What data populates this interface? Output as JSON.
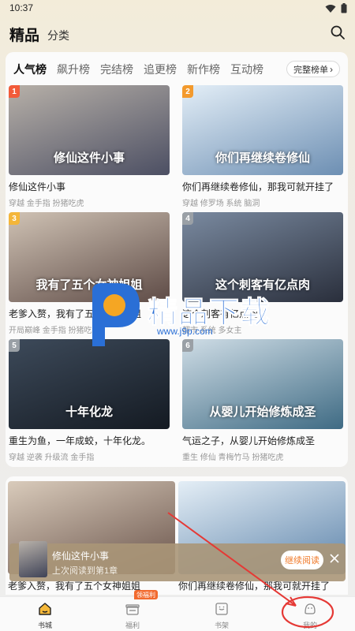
{
  "status_bar": {
    "time": "10:37"
  },
  "header": {
    "title": "精品",
    "subtitle": "分类"
  },
  "tabs": [
    "人气榜",
    "飙升榜",
    "完结榜",
    "追更榜",
    "新作榜",
    "互动榜"
  ],
  "active_tab_index": 0,
  "full_rank_label": "完整榜单",
  "books": [
    {
      "rank": "1",
      "title": "修仙这件小事",
      "tags": "穿越 金手指 扮猪吃虎",
      "cover_text": "修仙这件小事",
      "badge_color": "#f25b3a",
      "cover_colors": [
        "#b7b0a8",
        "#4c4f63"
      ]
    },
    {
      "rank": "2",
      "title": "你们再继续卷修仙，那我可就开挂了",
      "tags": "穿越 修罗场 系统 脑洞",
      "cover_text": "你们再继续卷修仙",
      "badge_color": "#f39a2d",
      "cover_colors": [
        "#e3eef7",
        "#6d8fb3"
      ]
    },
    {
      "rank": "3",
      "title": "老爹入赘，我有了五个女神姐姐",
      "tags": "开局巅峰 金手指 扮猪吃虎",
      "cover_text": "我有了五个女神姐姐",
      "badge_color": "#f4b63a",
      "cover_colors": [
        "#cfc2b4",
        "#5e4b46"
      ]
    },
    {
      "rank": "4",
      "title": "这个刺客有亿点肉",
      "tags": "都市 系统 多女主",
      "cover_text": "这个刺客有亿点肉",
      "badge_color": "#9aa0a6",
      "cover_colors": [
        "#7a8aa0",
        "#2a2f3c"
      ]
    },
    {
      "rank": "5",
      "title": "重生为鱼，一年成蛟，十年化龙。",
      "tags": "穿越 逆袭 升级流 金手指",
      "cover_text": "十年化龙",
      "badge_color": "#9aa0a6",
      "cover_colors": [
        "#3d4a5a",
        "#141a22"
      ]
    },
    {
      "rank": "6",
      "title": "气运之子，从婴儿开始修炼成圣",
      "tags": "重生 修仙 青梅竹马 扮猪吃虎",
      "cover_text": "从婴儿开始修炼成圣",
      "badge_color": "#9aa0a6",
      "cover_colors": [
        "#cfdde6",
        "#3f6b84"
      ]
    }
  ],
  "recommended": [
    {
      "title": "老爹入赘，我有了五个女神姐姐"
    },
    {
      "title": "你们再继续卷修仙，那我可就开挂了"
    }
  ],
  "continue_reading": {
    "book": "修仙这件小事",
    "progress": "上次阅读到第1章",
    "button": "继续阅读"
  },
  "watermark": {
    "text": "精品下载",
    "url": "www.j9p.com"
  },
  "nav": [
    {
      "label": "书城",
      "icon": "home-icon",
      "active": true
    },
    {
      "label": "福利",
      "icon": "gift-icon",
      "active": false
    },
    {
      "label": "书架",
      "icon": "bookshelf-icon",
      "active": false
    },
    {
      "label": "我的",
      "icon": "profile-icon",
      "active": false
    }
  ],
  "welfare_badge": "领福利",
  "colors": {
    "accent": "#f07a2a",
    "annotation": "#e53935",
    "brand_blue": "#2a6fd6"
  }
}
